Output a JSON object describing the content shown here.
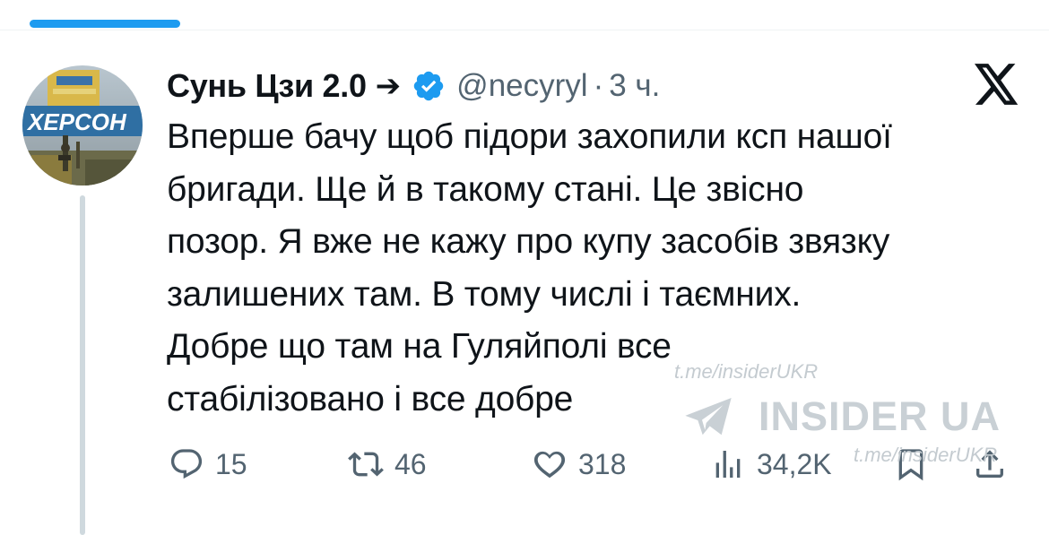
{
  "header": {
    "display_name": "Сунь Цзи 2.0",
    "arrow": "➔",
    "handle": "@necyryl",
    "separator": "·",
    "time": "3 ч."
  },
  "avatar": {
    "sign_text": "ХЕРСОН"
  },
  "tweet": {
    "lines": [
      "Вперше бачу щоб підори захопили ксп нашої",
      "бригади. Ще й в такому стані. Це звісно",
      "позор. Я вже не кажу про купу засобів звязку",
      "залишених там. В тому числі і таємних.",
      "Добре що там на Гуляйполі все",
      "стабілізовано і все добре"
    ]
  },
  "actions": {
    "replies": "15",
    "reposts": "46",
    "likes": "318",
    "views": "34,2K"
  },
  "watermark": {
    "url_top": "t.me/insiderUKR",
    "brand": "INSIDER UA",
    "url_bottom": "t.me/insiderUKR"
  },
  "colors": {
    "accent": "#1d9bf0",
    "secondary_text": "#536471",
    "primary_text": "#0f1419"
  }
}
